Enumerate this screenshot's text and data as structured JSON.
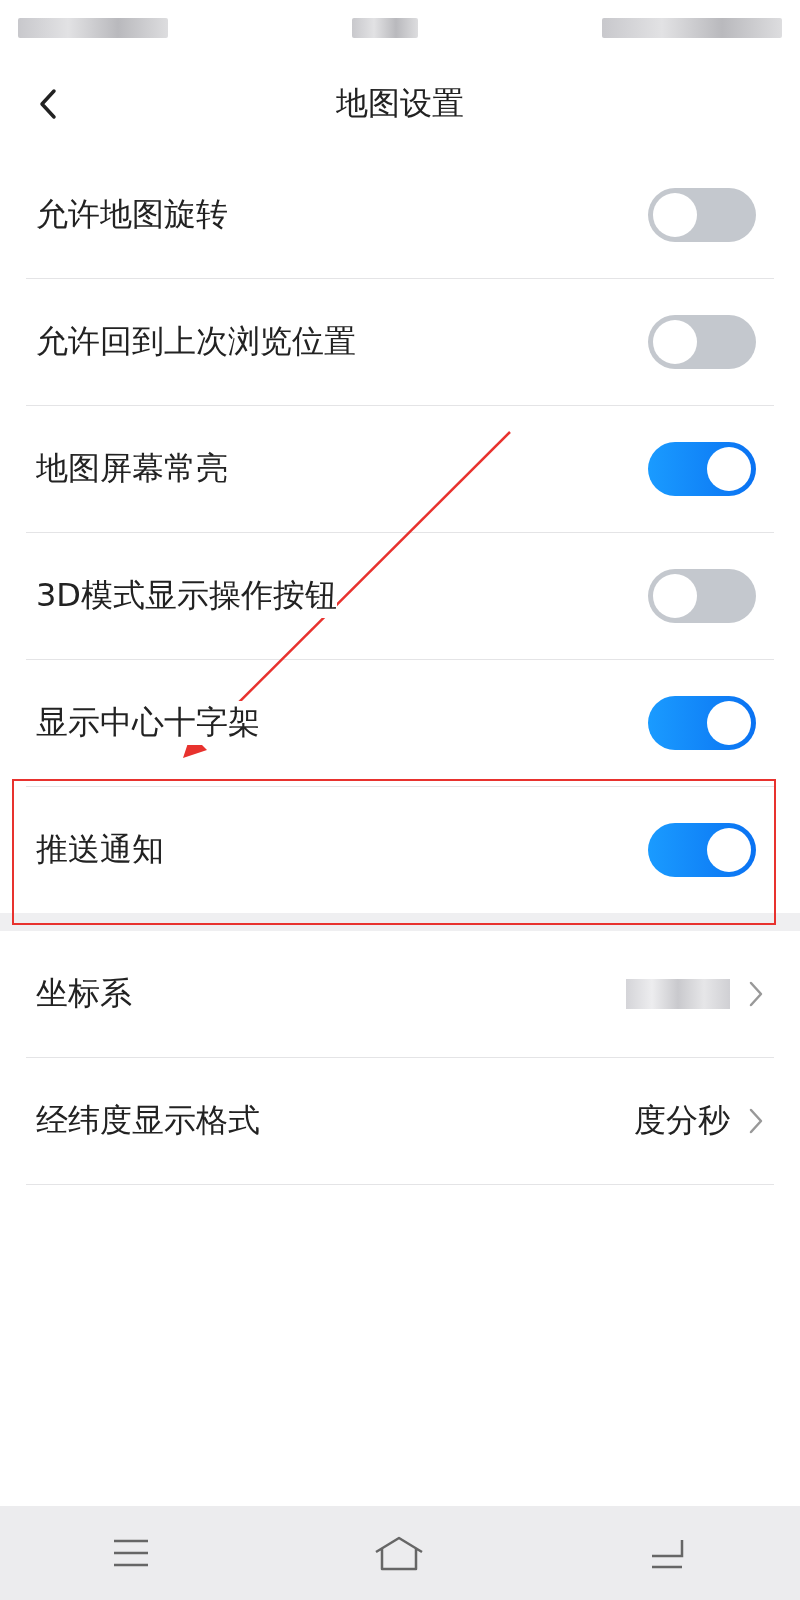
{
  "header": {
    "title": "地图设置"
  },
  "toggles": [
    {
      "label": "允许地图旋转",
      "on": false
    },
    {
      "label": "允许回到上次浏览位置",
      "on": false
    },
    {
      "label": "地图屏幕常亮",
      "on": true
    },
    {
      "label": "3D模式显示操作按钮",
      "on": false
    },
    {
      "label": "显示中心十字架",
      "on": true
    },
    {
      "label": "推送通知",
      "on": true,
      "highlighted": true
    }
  ],
  "options": [
    {
      "label": "坐标系",
      "kind": "redacted"
    },
    {
      "label": "经纬度显示格式",
      "kind": "text",
      "value": "度分秒"
    }
  ]
}
